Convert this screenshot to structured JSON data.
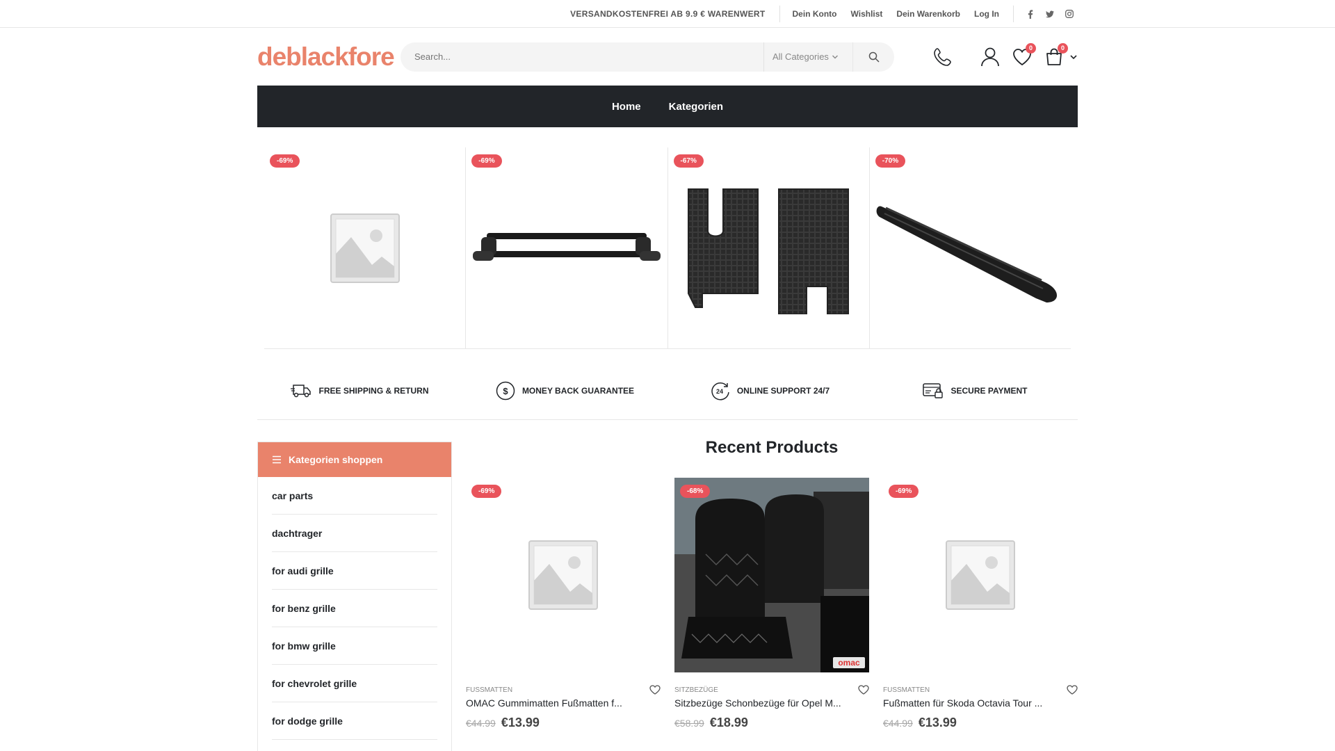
{
  "topbar": {
    "promo": "VERSANDKOSTENFREI AB 9.9 € WARENWERT",
    "links": [
      "Dein Konto",
      "Wishlist",
      "Dein Warenkorb",
      "Log In"
    ],
    "social_icons": [
      "facebook-icon",
      "twitter-icon",
      "instagram-icon"
    ]
  },
  "header": {
    "logo": "deblackfore",
    "search_placeholder": "Search...",
    "category_select": "All Categories",
    "wishlist_count": "0",
    "cart_count": "0"
  },
  "nav": {
    "items": [
      "Home",
      "Kategorien"
    ]
  },
  "slider": {
    "items": [
      {
        "discount": "-69%",
        "image": "placeholder"
      },
      {
        "discount": "-69%",
        "image": "roof-rack"
      },
      {
        "discount": "-67%",
        "image": "floor-mats"
      },
      {
        "discount": "-70%",
        "image": "running-board"
      }
    ]
  },
  "features": [
    {
      "icon": "truck-icon",
      "label": "FREE SHIPPING & RETURN"
    },
    {
      "icon": "dollar-icon",
      "label": "MONEY BACK GUARANTEE"
    },
    {
      "icon": "support-24-icon",
      "label": "ONLINE SUPPORT 24/7"
    },
    {
      "icon": "card-lock-icon",
      "label": "SECURE PAYMENT"
    }
  ],
  "sidebar": {
    "title": "Kategorien shoppen",
    "items": [
      "car parts",
      "dachtrager",
      "for audi grille",
      "for benz grille",
      "for bmw grille",
      "for chevrolet grille",
      "for dodge grille"
    ]
  },
  "recent": {
    "title": "Recent Products",
    "products": [
      {
        "discount": "-69%",
        "category": "FUSSMATTEN",
        "name": "OMAC Gummimatten Fußmatten f...",
        "old_price": "€44.99",
        "price": "€13.99",
        "image": "placeholder"
      },
      {
        "discount": "-68%",
        "category": "SITZBEZÜGE",
        "name": "Sitzbezüge Schonbezüge für Opel M...",
        "old_price": "€58.99",
        "price": "€18.99",
        "image": "seat-covers",
        "brand": "omac"
      },
      {
        "discount": "-69%",
        "category": "FUSSMATTEN",
        "name": "Fußmatten für Skoda Octavia Tour ...",
        "old_price": "€44.99",
        "price": "€13.99",
        "image": "placeholder"
      }
    ]
  }
}
